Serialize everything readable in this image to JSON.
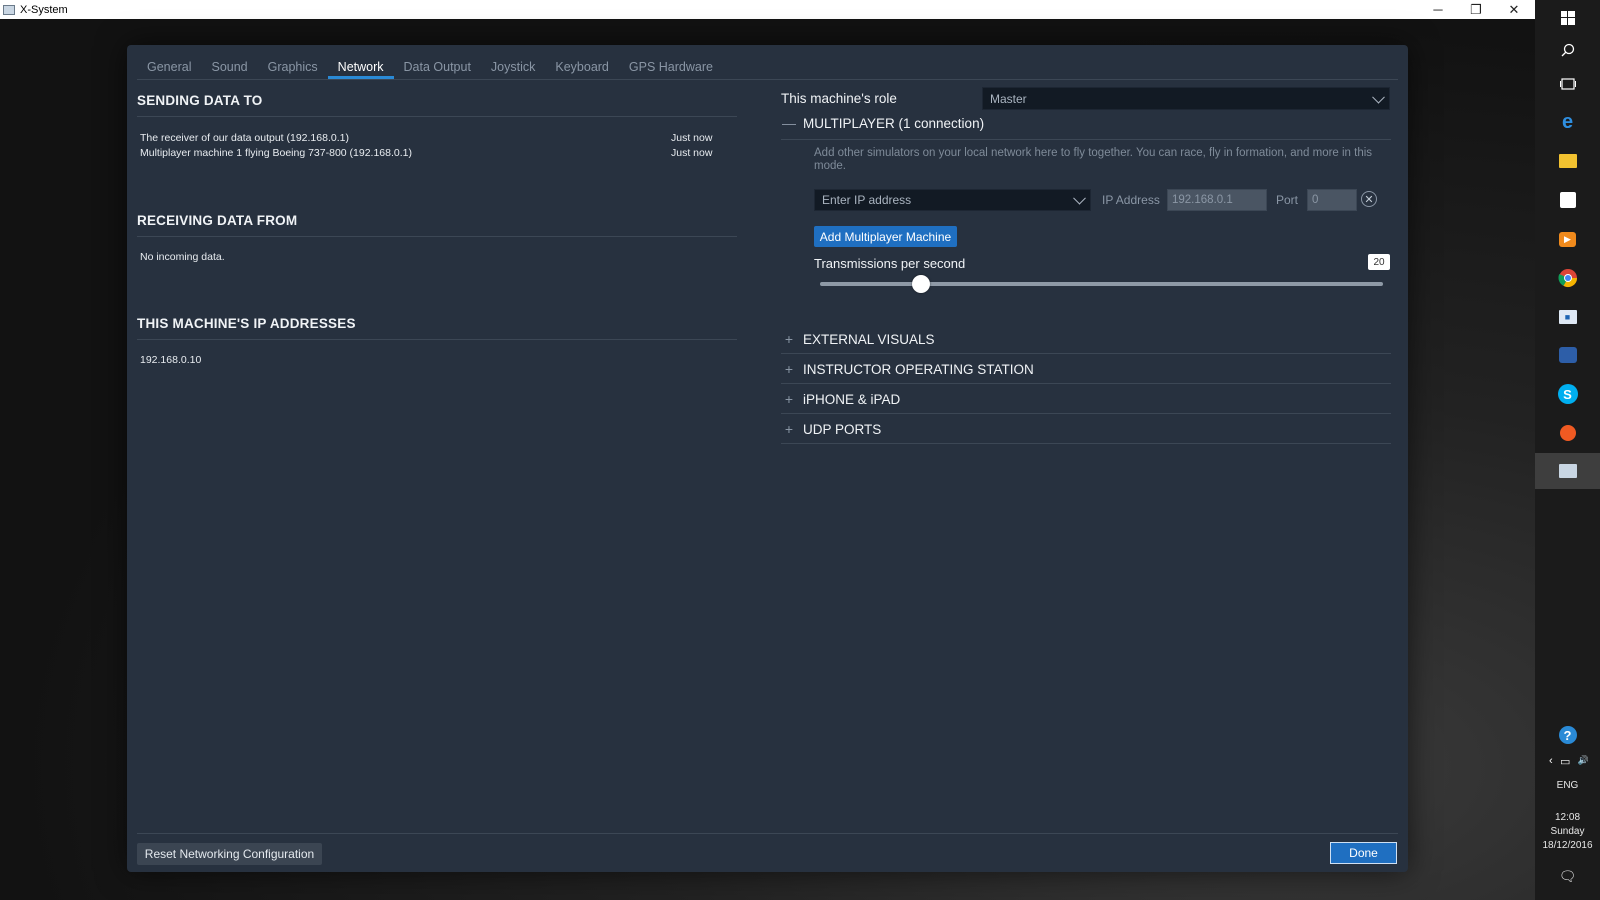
{
  "window": {
    "title": "X-System",
    "minimize": "─",
    "restore": "❐",
    "close": "✕"
  },
  "tabs": [
    "General",
    "Sound",
    "Graphics",
    "Network",
    "Data Output",
    "Joystick",
    "Keyboard",
    "GPS Hardware"
  ],
  "active_tab": "Network",
  "sending": {
    "title": "SENDING DATA TO",
    "rows": [
      {
        "label": "The receiver of our data output (192.168.0.1)",
        "time": "Just now"
      },
      {
        "label": "Multiplayer machine 1 flying Boeing 737-800 (192.168.0.1)",
        "time": "Just now"
      }
    ]
  },
  "receiving": {
    "title": "RECEIVING DATA FROM",
    "empty_text": "No incoming data."
  },
  "ip_addresses": {
    "title": "THIS MACHINE'S IP ADDRESSES",
    "items": [
      "192.168.0.10"
    ]
  },
  "role": {
    "label": "This machine's role",
    "value": "Master"
  },
  "multiplayer": {
    "toggle": "—",
    "title": "MULTIPLAYER (1 connection)",
    "description": "Add other simulators on your local network here to fly together. You can race, fly in formation, and more in this mode.",
    "ip_select_placeholder": "Enter IP address",
    "ip_address_label": "IP Address",
    "ip_address_value": "192.168.0.1",
    "port_label": "Port",
    "port_value": "0",
    "remove_glyph": "✕",
    "add_button": "Add Multiplayer Machine",
    "tps_label": "Transmissions per second",
    "tps_value": "20",
    "tps_level_fraction": 0.18
  },
  "collapsed_groups": [
    {
      "toggle": "+",
      "title": "EXTERNAL VISUALS"
    },
    {
      "toggle": "+",
      "title": "INSTRUCTOR OPERATING STATION"
    },
    {
      "toggle": "+",
      "title": "iPHONE & iPAD"
    },
    {
      "toggle": "+",
      "title": "UDP PORTS"
    }
  ],
  "footer": {
    "reset_button": "Reset Networking Configuration",
    "done_button": "Done"
  },
  "taskbar": {
    "icons": [
      "windows-start-icon",
      "search-icon",
      "task-view-icon",
      "edge-browser-icon",
      "file-explorer-icon",
      "store-icon",
      "media-player-icon",
      "chrome-icon",
      "remote-desktop-icon",
      "network-app-icon",
      "skype-icon",
      "origin-icon",
      "xsystem-app-icon"
    ],
    "tray": {
      "language": "ENG",
      "time": "12:08",
      "day": "Sunday",
      "date": "18/12/2016"
    },
    "help_glyph": "?",
    "chevron_glyph": "‹",
    "network_glyph": "▭",
    "volume_glyph": "🔊",
    "notification_glyph": "🗨"
  },
  "colors": {
    "accent": "#1f6fc1",
    "panel": "#27313f",
    "tab_underline": "#2a8ad6"
  }
}
